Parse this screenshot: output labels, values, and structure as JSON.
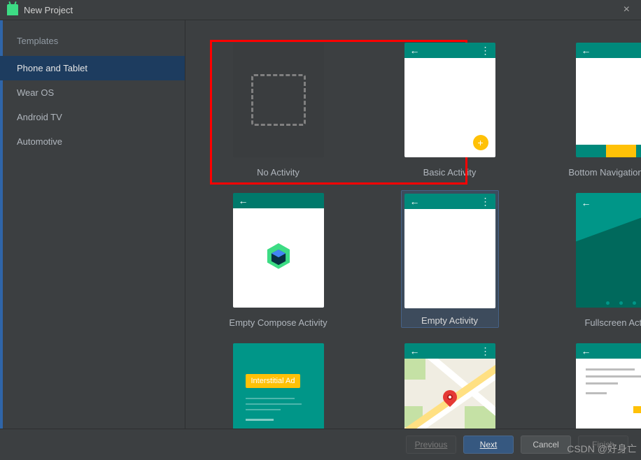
{
  "window": {
    "title": "New Project"
  },
  "sidebar": {
    "heading": "Templates",
    "items": [
      {
        "label": "Phone and Tablet",
        "active": true
      },
      {
        "label": "Wear OS",
        "active": false
      },
      {
        "label": "Android TV",
        "active": false
      },
      {
        "label": "Automotive",
        "active": false
      }
    ]
  },
  "templates": [
    {
      "id": "no_activity",
      "label": "No Activity",
      "selected": false
    },
    {
      "id": "basic_activity",
      "label": "Basic Activity",
      "selected": false
    },
    {
      "id": "bottom_nav",
      "label": "Bottom Navigation Activity",
      "selected": false
    },
    {
      "id": "empty_compose",
      "label": "Empty Compose Activity",
      "selected": false
    },
    {
      "id": "empty_activity",
      "label": "Empty Activity",
      "selected": true
    },
    {
      "id": "fullscreen",
      "label": "Fullscreen Activity",
      "selected": false
    },
    {
      "id": "ad",
      "label": "Interstitial Ad",
      "ad_text": "Interstitial Ad",
      "selected": false
    },
    {
      "id": "maps",
      "label": "",
      "selected": false
    },
    {
      "id": "primary_detail",
      "label": "",
      "selected": false
    }
  ],
  "buttons": {
    "previous": "Previous",
    "next": "Next",
    "cancel": "Cancel",
    "finish": "Finish"
  },
  "watermark": "CSDN @好身亡"
}
